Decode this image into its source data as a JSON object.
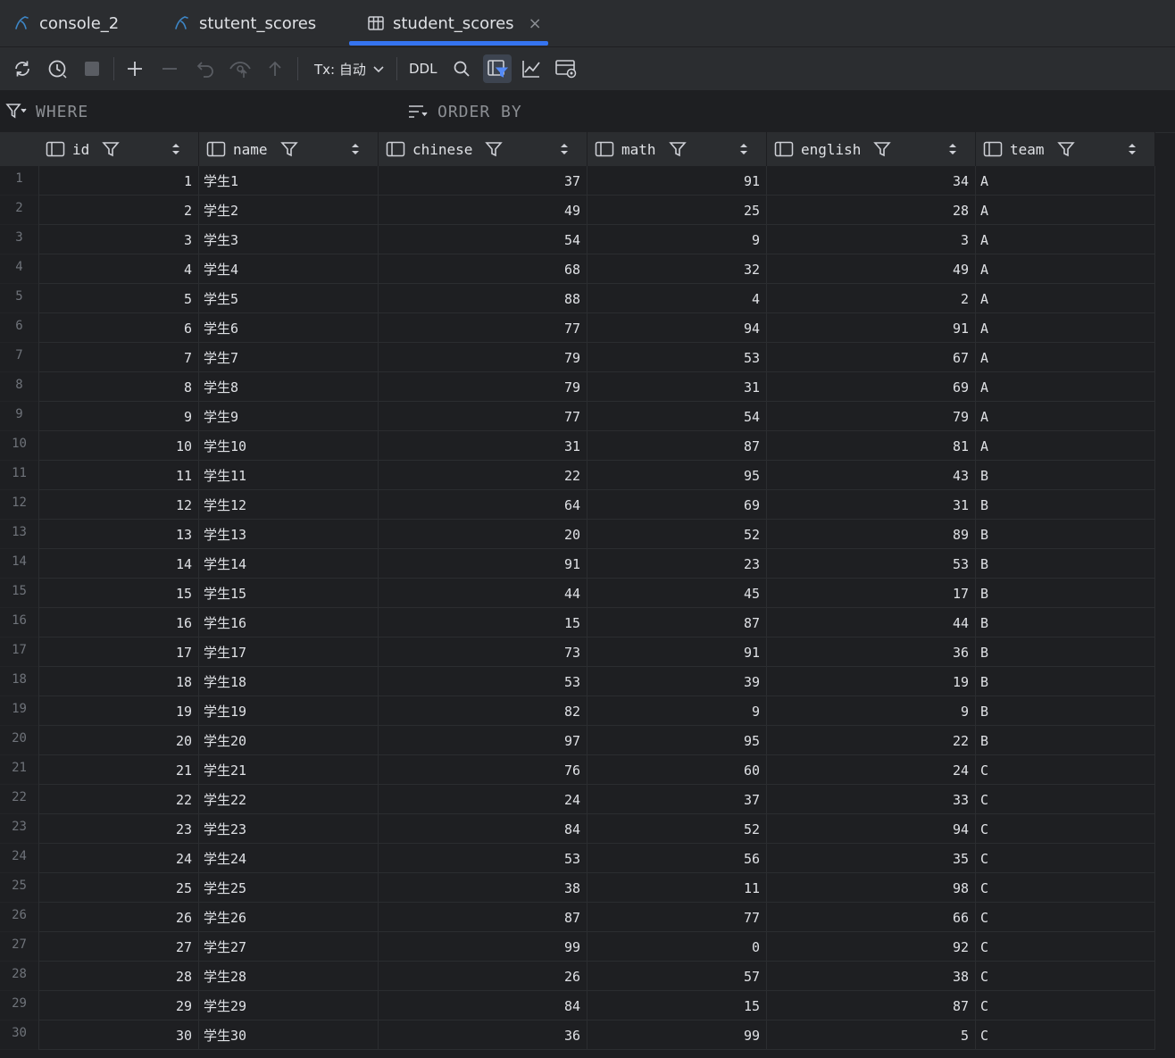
{
  "tabs": [
    {
      "label": "console_2",
      "icon": "mysql-console-icon",
      "active": false
    },
    {
      "label": "stutent_scores",
      "icon": "mysql-console-icon",
      "active": false
    },
    {
      "label": "student_scores",
      "icon": "table-icon",
      "active": true,
      "close": "×"
    }
  ],
  "toolbar": {
    "tx_label": "Tx: 自动",
    "ddl_label": "DDL",
    "accent": "#3574f0"
  },
  "filter": {
    "where_label": "WHERE",
    "orderby_label": "ORDER BY"
  },
  "columns": [
    "id",
    "name",
    "chinese",
    "math",
    "english",
    "team"
  ],
  "rows": [
    [
      1,
      "学生1",
      37,
      91,
      34,
      "A"
    ],
    [
      2,
      "学生2",
      49,
      25,
      28,
      "A"
    ],
    [
      3,
      "学生3",
      54,
      9,
      3,
      "A"
    ],
    [
      4,
      "学生4",
      68,
      32,
      49,
      "A"
    ],
    [
      5,
      "学生5",
      88,
      4,
      2,
      "A"
    ],
    [
      6,
      "学生6",
      77,
      94,
      91,
      "A"
    ],
    [
      7,
      "学生7",
      79,
      53,
      67,
      "A"
    ],
    [
      8,
      "学生8",
      79,
      31,
      69,
      "A"
    ],
    [
      9,
      "学生9",
      77,
      54,
      79,
      "A"
    ],
    [
      10,
      "学生10",
      31,
      87,
      81,
      "A"
    ],
    [
      11,
      "学生11",
      22,
      95,
      43,
      "B"
    ],
    [
      12,
      "学生12",
      64,
      69,
      31,
      "B"
    ],
    [
      13,
      "学生13",
      20,
      52,
      89,
      "B"
    ],
    [
      14,
      "学生14",
      91,
      23,
      53,
      "B"
    ],
    [
      15,
      "学生15",
      44,
      45,
      17,
      "B"
    ],
    [
      16,
      "学生16",
      15,
      87,
      44,
      "B"
    ],
    [
      17,
      "学生17",
      73,
      91,
      36,
      "B"
    ],
    [
      18,
      "学生18",
      53,
      39,
      19,
      "B"
    ],
    [
      19,
      "学生19",
      82,
      9,
      9,
      "B"
    ],
    [
      20,
      "学生20",
      97,
      95,
      22,
      "B"
    ],
    [
      21,
      "学生21",
      76,
      60,
      24,
      "C"
    ],
    [
      22,
      "学生22",
      24,
      37,
      33,
      "C"
    ],
    [
      23,
      "学生23",
      84,
      52,
      94,
      "C"
    ],
    [
      24,
      "学生24",
      53,
      56,
      35,
      "C"
    ],
    [
      25,
      "学生25",
      38,
      11,
      98,
      "C"
    ],
    [
      26,
      "学生26",
      87,
      77,
      66,
      "C"
    ],
    [
      27,
      "学生27",
      99,
      0,
      92,
      "C"
    ],
    [
      28,
      "学生28",
      26,
      57,
      38,
      "C"
    ],
    [
      29,
      "学生29",
      84,
      15,
      87,
      "C"
    ],
    [
      30,
      "学生30",
      36,
      99,
      5,
      "C"
    ]
  ]
}
